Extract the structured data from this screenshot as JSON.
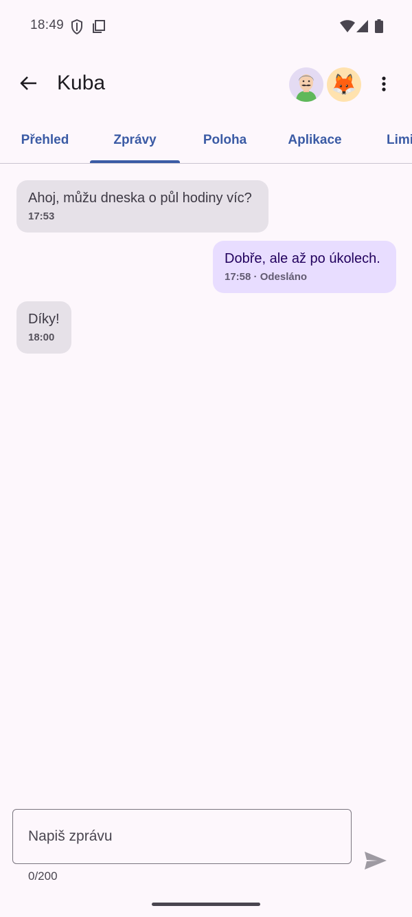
{
  "status_bar": {
    "time": "18:49",
    "icons": [
      "shield-icon",
      "screen-cast-icon",
      "wifi-icon",
      "signal-icon",
      "battery-icon"
    ]
  },
  "app_bar": {
    "title": "Kuba",
    "back_icon": "arrow-back-icon",
    "avatars": [
      "parent-avatar",
      "fox-avatar"
    ],
    "fox_emoji": "🦊",
    "more_icon": "more-vert-icon"
  },
  "tabs": [
    {
      "label": "Přehled",
      "active": false
    },
    {
      "label": "Zprávy",
      "active": true
    },
    {
      "label": "Poloha",
      "active": false
    },
    {
      "label": "Aplikace",
      "active": false
    },
    {
      "label": "Limi",
      "active": false
    }
  ],
  "messages": [
    {
      "direction": "incoming",
      "text": "Ahoj, můžu dneska o půl hodiny víc?",
      "meta": "17:53"
    },
    {
      "direction": "outgoing",
      "text": "Dobře, ale až po úkolech.",
      "meta": "17:58 · Odesláno"
    },
    {
      "direction": "incoming",
      "text": "Díky!",
      "meta": "18:00"
    }
  ],
  "composer": {
    "placeholder": "Napiš zprávu",
    "value": "",
    "counter": "0/200",
    "send_icon": "send-icon"
  },
  "colors": {
    "background": "#fdf7fc",
    "accent": "#3b5ba5",
    "incoming_bubble": "#e6e1e8",
    "outgoing_bubble": "#e8ddff"
  }
}
